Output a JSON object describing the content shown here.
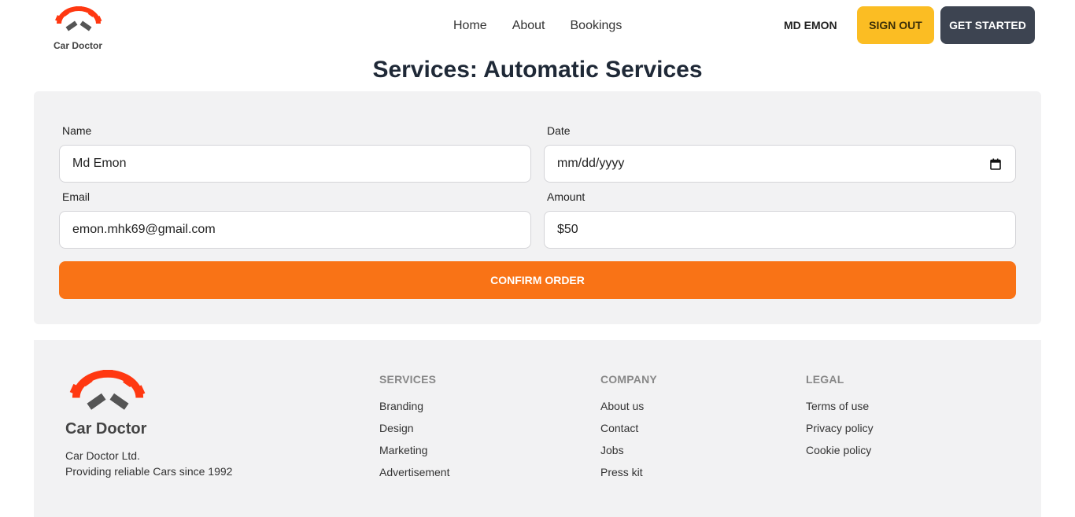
{
  "nav": {
    "brand": "Car Doctor",
    "links": [
      "Home",
      "About",
      "Bookings"
    ],
    "user_name": "MD EMON",
    "sign_out": "SIGN OUT",
    "get_started": "GET STARTED"
  },
  "page": {
    "title": "Services: Automatic Services"
  },
  "form": {
    "name_label": "Name",
    "name_value": "Md Emon",
    "date_label": "Date",
    "date_placeholder": "mm/dd/yyyy",
    "email_label": "Email",
    "email_value": "emon.mhk69@gmail.com",
    "amount_label": "Amount",
    "amount_value": "$50",
    "confirm_label": "CONFIRM ORDER"
  },
  "footer": {
    "brand": "Car Doctor",
    "company_line": "Car Doctor Ltd.",
    "tagline": "Providing reliable Cars since 1992",
    "services": {
      "heading": "SERVICES",
      "items": [
        "Branding",
        "Design",
        "Marketing",
        "Advertisement"
      ]
    },
    "company": {
      "heading": "COMPANY",
      "items": [
        "About us",
        "Contact",
        "Jobs",
        "Press kit"
      ]
    },
    "legal": {
      "heading": "LEGAL",
      "items": [
        "Terms of use",
        "Privacy policy",
        "Cookie policy"
      ]
    }
  },
  "colors": {
    "accent_orange": "#f97316",
    "signout_yellow": "#fbbd23",
    "dark_button": "#3d4451",
    "logo_red": "#ff3811"
  },
  "icons": [
    "car-doctor-logo-icon",
    "calendar-icon"
  ]
}
